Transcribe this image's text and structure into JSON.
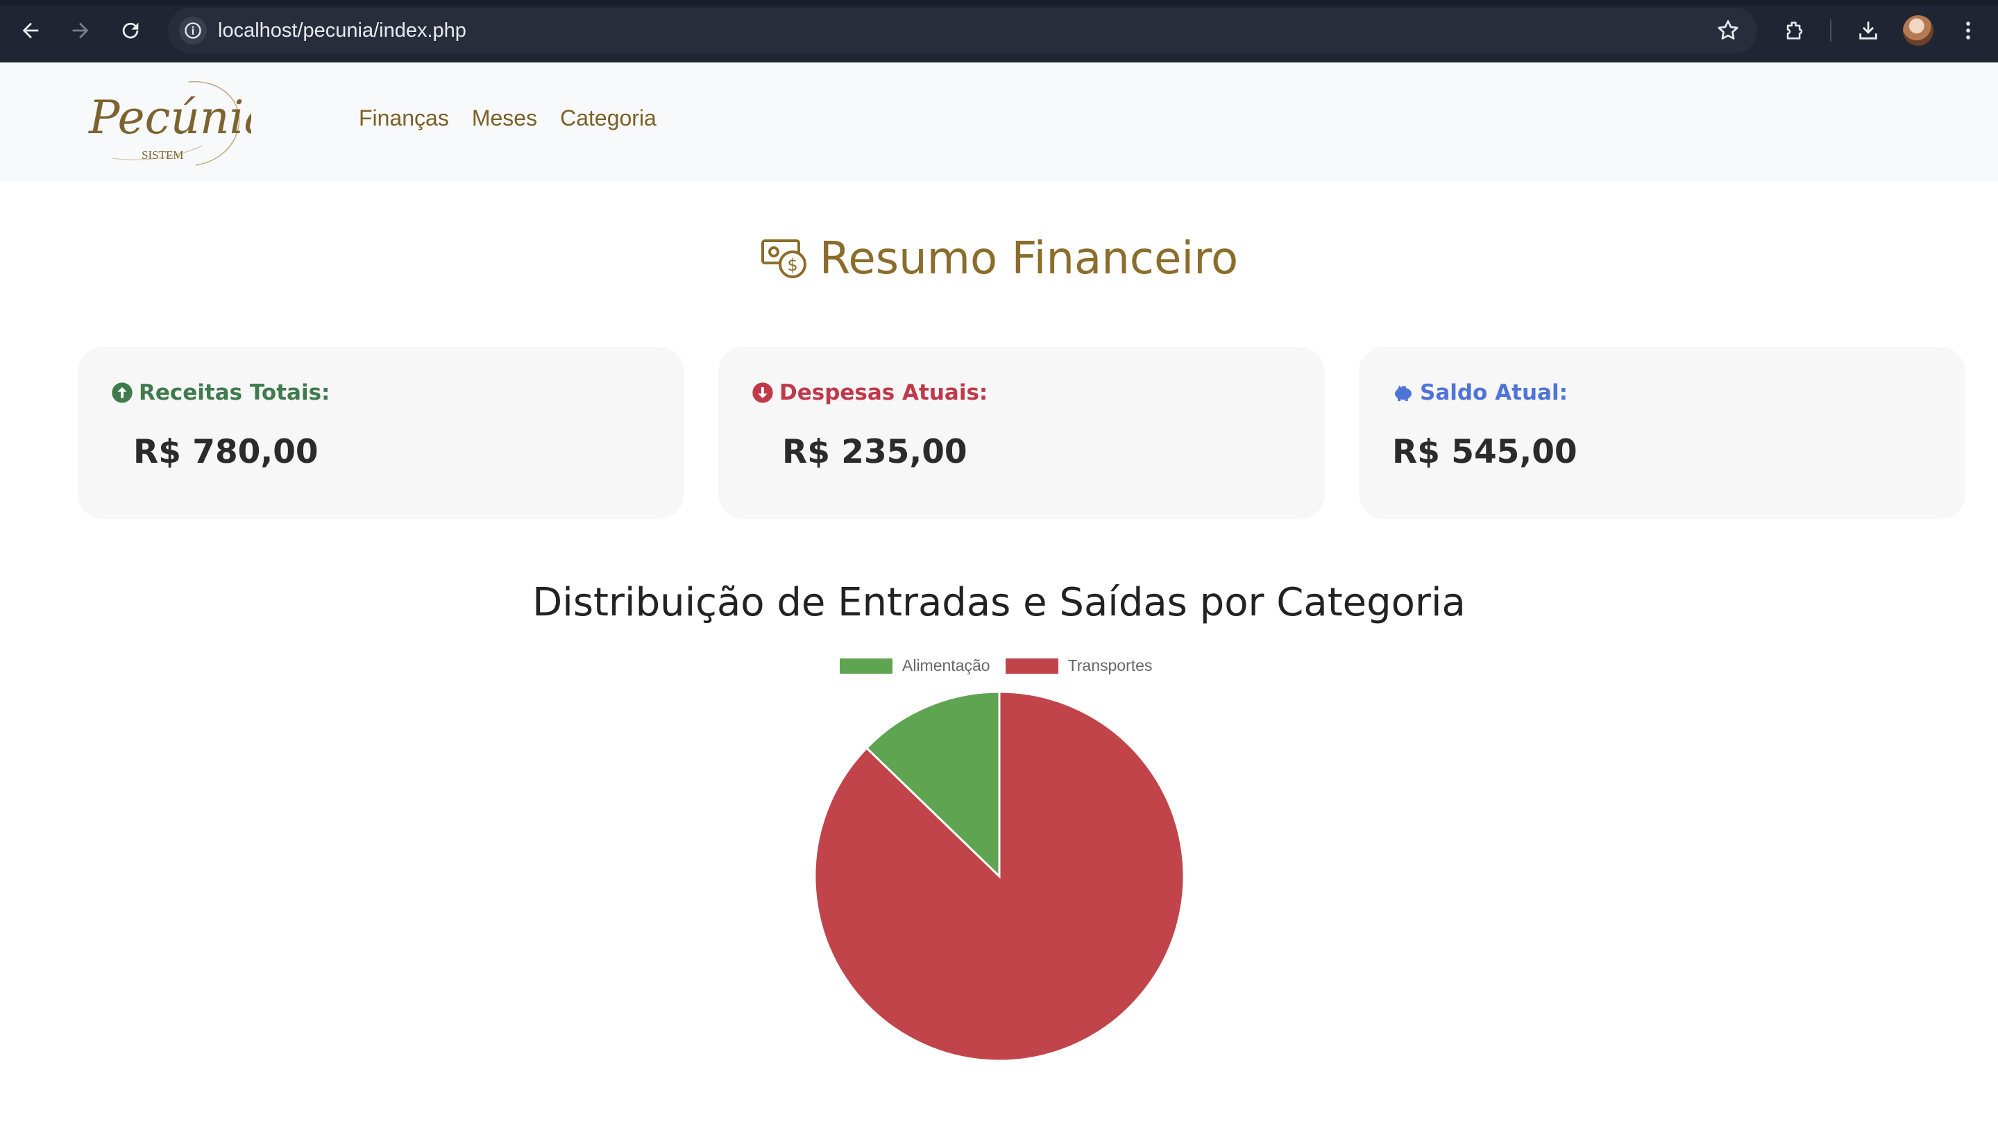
{
  "browser": {
    "url": "localhost/pecunia/index.php"
  },
  "header": {
    "logo_text": "Pecúnia",
    "logo_subtext": "SISTEM",
    "menu": [
      {
        "label": "Finanças"
      },
      {
        "label": "Meses"
      },
      {
        "label": "Categoria"
      }
    ]
  },
  "page": {
    "title": "Resumo Financeiro"
  },
  "cards": [
    {
      "label": "Receitas Totais:",
      "value": "R$ 780,00",
      "color": "#3f7b4d",
      "icon": "arrow-up-circle-icon"
    },
    {
      "label": "Despesas Atuais:",
      "value": "R$ 235,00",
      "color": "#c0394a",
      "icon": "arrow-down-circle-icon"
    },
    {
      "label": "Saldo Atual:",
      "value": "R$ 545,00",
      "color": "#4f74d9",
      "icon": "piggy-bank-icon"
    }
  ],
  "chart_data": {
    "type": "pie",
    "title": "Distribuição de Entradas e Saídas por Categoria",
    "legend_position": "top",
    "series": [
      {
        "name": "Alimentação",
        "value": 30,
        "color": "#5ea451"
      },
      {
        "name": "Transportes",
        "value": 205,
        "color": "#c0444a"
      }
    ],
    "start_angle_deg": -90
  }
}
